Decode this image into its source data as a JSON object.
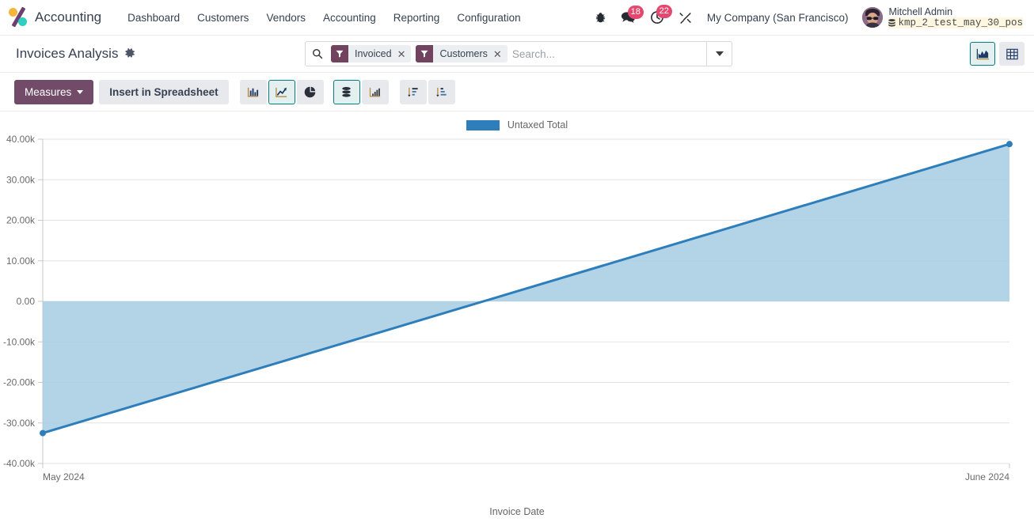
{
  "navbar": {
    "brand": "Accounting",
    "menu": [
      {
        "label": "Dashboard"
      },
      {
        "label": "Customers"
      },
      {
        "label": "Vendors"
      },
      {
        "label": "Accounting"
      },
      {
        "label": "Reporting"
      },
      {
        "label": "Configuration"
      }
    ],
    "debug_icon": "bug-icon",
    "messages_badge": "18",
    "activities_badge": "22",
    "wrench_icon": "wrench-icon",
    "company": "My Company (San Francisco)",
    "user_name": "Mitchell Admin",
    "database": "kmp_2_test_may_30_pos"
  },
  "control_panel": {
    "title": "Invoices Analysis",
    "gear_icon": "gear-icon",
    "search": {
      "placeholder": "Search...",
      "value": "",
      "search_icon": "search-icon",
      "toggle_icon": "chevron-down-icon",
      "facets": [
        {
          "label": "Invoiced",
          "icon": "filter-icon",
          "remove": "✕"
        },
        {
          "label": "Customers",
          "icon": "filter-icon",
          "remove": "✕"
        }
      ]
    },
    "view_switcher": [
      {
        "name": "graph-view",
        "icon": "area-chart-icon",
        "active": true
      },
      {
        "name": "pivot-view",
        "icon": "pivot-table-icon",
        "active": false
      }
    ]
  },
  "toolbar": {
    "measures_label": "Measures",
    "spreadsheet_label": "Insert in Spreadsheet",
    "chart_types": [
      {
        "name": "bar-chart",
        "icon": "bar-chart-icon",
        "active": false
      },
      {
        "name": "line-chart",
        "icon": "line-chart-icon",
        "active": true
      },
      {
        "name": "pie-chart",
        "icon": "pie-chart-icon",
        "active": false
      }
    ],
    "modes": [
      {
        "name": "stacked",
        "icon": "stacked-icon",
        "active": true
      },
      {
        "name": "cumulative",
        "icon": "ascending-bars-icon",
        "active": false
      }
    ],
    "sorts": [
      {
        "name": "sort-descending",
        "icon": "sort-descending-icon",
        "active": false
      },
      {
        "name": "sort-ascending",
        "icon": "sort-ascending-icon",
        "active": false
      }
    ]
  },
  "chart_data": {
    "type": "area",
    "title": "",
    "subtitle": "",
    "xlabel": "Invoice Date",
    "ylabel": "",
    "legend": [
      "Untaxed Total"
    ],
    "legend_position": "top",
    "grid": true,
    "series": [
      {
        "name": "Untaxed Total",
        "color": "#2e7ebb",
        "fill_color": "#a6cbe3",
        "values": [
          -32500,
          38800
        ]
      }
    ],
    "categories": [
      "May 2024",
      "June 2024"
    ],
    "x": [
      "May 2024",
      "June 2024"
    ],
    "xtick_labels": [
      "May 2024",
      "June 2024"
    ],
    "ytick_labels": [
      "40.00k",
      "30.00k",
      "20.00k",
      "10.00k",
      "0.00",
      "-10.00k",
      "-20.00k",
      "-30.00k",
      "-40.00k"
    ],
    "ytick_values": [
      40000,
      30000,
      20000,
      10000,
      0,
      -10000,
      -20000,
      -30000,
      -40000
    ],
    "ylim": [
      -40000,
      40000
    ],
    "baseline": 0
  }
}
